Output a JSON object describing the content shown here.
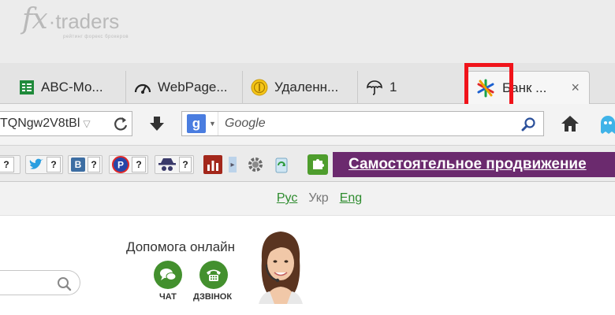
{
  "watermark": {
    "brand": "fx",
    "brand_rest": "traders",
    "subtitle": "рейтинг форекс брокеров"
  },
  "tabs": [
    {
      "label": "ABC-Мо...",
      "icon": "spreadsheet-icon"
    },
    {
      "label": "WebPage...",
      "icon": "speedometer-icon"
    },
    {
      "label": "Удаленн...",
      "icon": "coin-icon"
    },
    {
      "label": "1",
      "icon": "umbrella-icon"
    },
    {
      "label": "Банк ...",
      "icon": "bank-logo-icon",
      "active": true
    }
  ],
  "tab_close": "×",
  "nav": {
    "url_value": "TQNgw2V8tBl",
    "search_placeholder": "Google",
    "search_engine_letter": "g"
  },
  "bookmarks": {
    "q": "?"
  },
  "promo_text": "Самостоятельное продвижение",
  "languages": {
    "rus": "Рус",
    "ukr": "Укр",
    "eng": "Eng"
  },
  "help": {
    "title": "Допомога онлайн",
    "chat_label": "ЧАТ",
    "call_label": "ДЗВІНОК"
  },
  "colors": {
    "promo": "#6b2a6e",
    "accent_green": "#43902e",
    "highlight": "#f0131a",
    "link_green": "#2e8c2e"
  }
}
